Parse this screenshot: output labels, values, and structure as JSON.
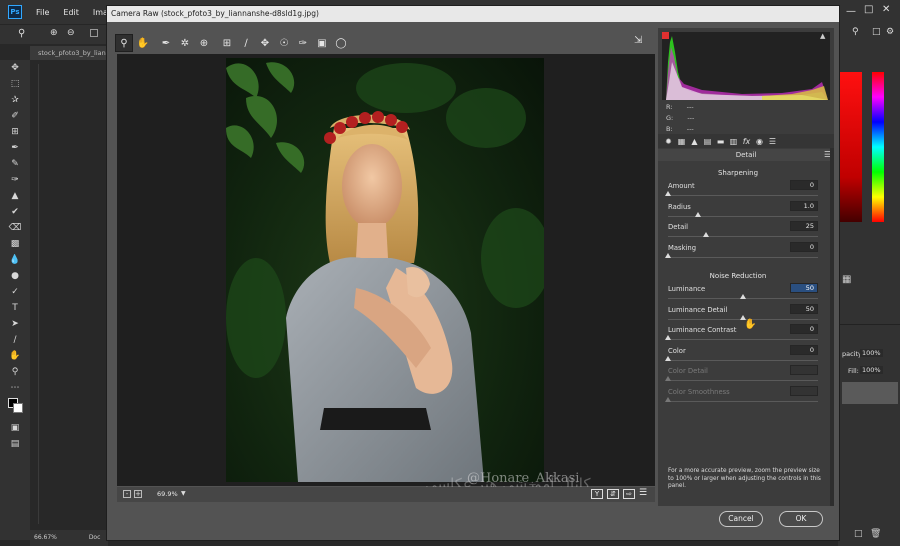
{
  "ps": {
    "logo": "Ps",
    "menus": [
      "File",
      "Edit",
      "Image"
    ],
    "doc_tab": "stock_pfoto3_by_lian",
    "zoom_status": "66.67%",
    "status_doc": "Doc",
    "right_panel": {
      "opacity_label": "pacity:",
      "opacity_value": "100%",
      "fill_label": "Fill:",
      "fill_value": "100%"
    }
  },
  "camera_raw": {
    "title": "Camera Raw (stock_pfoto3_by_liannanshe-d8sld1g.jpg)",
    "toolbar_icons": [
      "zoom-tool-icon",
      "hand-tool-icon",
      "white-balance-icon",
      "color-sampler-icon",
      "targeted-adjustment-icon",
      "crop-icon",
      "straighten-icon",
      "spot-removal-icon",
      "red-eye-icon",
      "adjustment-brush-icon",
      "graduated-filter-icon",
      "radial-filter-icon"
    ],
    "zoom_level": "69.9%",
    "rgb": {
      "r_label": "R:",
      "g_label": "G:",
      "b_label": "B:",
      "r": "---",
      "g": "---",
      "b": "---"
    },
    "panel_title": "Detail",
    "sharpening": {
      "title": "Sharpening",
      "sliders": [
        {
          "label": "Amount",
          "value": "0",
          "pos": 0.0
        },
        {
          "label": "Radius",
          "value": "1.0",
          "pos": 0.2
        },
        {
          "label": "Detail",
          "value": "25",
          "pos": 0.25
        },
        {
          "label": "Masking",
          "value": "0",
          "pos": 0.0
        }
      ]
    },
    "noise_reduction": {
      "title": "Noise Reduction",
      "sliders": [
        {
          "label": "Luminance",
          "value": "50",
          "pos": 0.5,
          "selected": true
        },
        {
          "label": "Luminance Detail",
          "value": "50",
          "pos": 0.5
        },
        {
          "label": "Luminance Contrast",
          "value": "0",
          "pos": 0.0
        },
        {
          "label": "Color",
          "value": "0",
          "pos": 0.0
        },
        {
          "label": "Color Detail",
          "value": "",
          "pos": 0.0,
          "disabled": true
        },
        {
          "label": "Color Smoothness",
          "value": "",
          "pos": 0.0,
          "disabled": true
        }
      ]
    },
    "note": "For a more accurate preview, zoom the preview size to 100% or larger when adjusting the controls in this panel.",
    "cancel": "Cancel",
    "ok": "OK"
  },
  "watermark": {
    "handle": "@Honare_Akkasi",
    "channel": "کانال آموزشی هنر عکاسی"
  }
}
